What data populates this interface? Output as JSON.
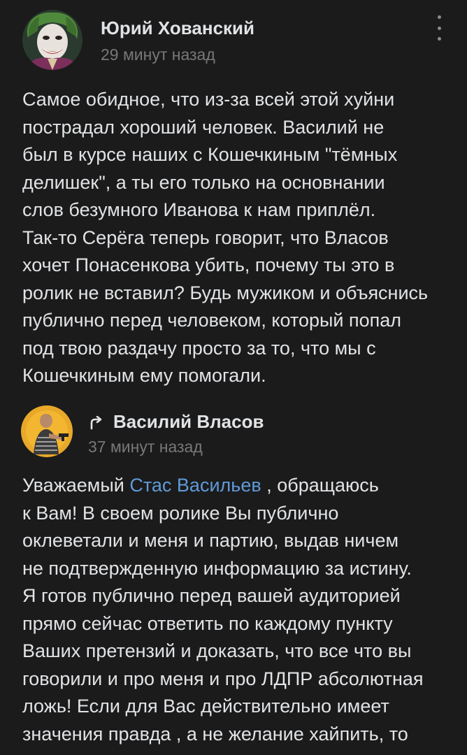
{
  "comments": [
    {
      "author": "Юрий Хованский",
      "time": "29 минут назад",
      "avatar_icon": "joker-avatar",
      "lines": [
        "Самое обидное, что из-за всей этой хуйни",
        "пострадал хороший человек. Василий не",
        "был в курсе наших с Кошечкиным \"тёмных",
        "делишек\", а ты его только на основнании",
        "слов безумного Иванова к нам приплёл.",
        "Так-то Серёга теперь говорит, что Власов",
        "хочет Понасенкова убить, почему ты это в",
        "ролик не вставил? Будь мужиком и объяснись",
        "публично перед человеком, который попал",
        "под твою раздачу просто за то, что мы с",
        "Кошечкиным ему помогали."
      ]
    },
    {
      "author": "Василий Власов",
      "time": "37 минут назад",
      "avatar_icon": "man-with-gun-avatar",
      "reply_icon": "reply-arrow-icon",
      "first_line_prefix": "Уважаемый ",
      "mention": "Стас Васильев",
      "first_line_suffix": " , обращаюсь",
      "lines": [
        "к Вам! В своем ролике Вы публично",
        "оклеветали и меня и партию, выдав ничем",
        "не подтвержденную информацию за истину.",
        "Я готов публично перед вашей аудиторией",
        "прямо сейчас ответить по каждому пункту",
        "Ваших претензий и доказать, что все что вы",
        "говорили и про меня и про ЛДПР абсолютная",
        "ложь! Если для Вас действительно имеет",
        "значения правда , а не желание хайпить, то"
      ]
    }
  ],
  "colors": {
    "background": "#1b1b1b",
    "text": "#e1e3e6",
    "secondary": "#76787a",
    "link": "#5f9ad8"
  }
}
